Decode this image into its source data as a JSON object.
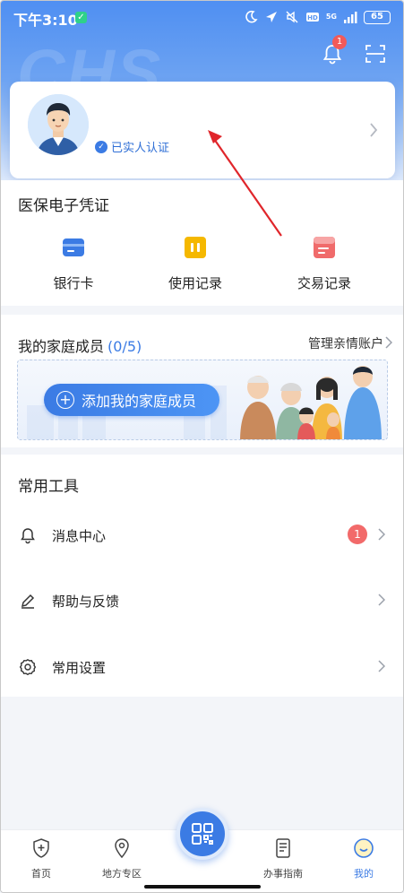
{
  "status_bar": {
    "time": "下午3:10",
    "battery": "65",
    "network": "5G"
  },
  "header": {
    "bell_badge": "1",
    "watermark": "CHS"
  },
  "profile": {
    "verified_label": "已实人认证"
  },
  "voucher": {
    "title": "医保电子凭证",
    "items": [
      {
        "label": "银行卡",
        "icon": "bank-card-icon",
        "color": "#3b7be4"
      },
      {
        "label": "使用记录",
        "icon": "usage-record-icon",
        "color": "#f5b800"
      },
      {
        "label": "交易记录",
        "icon": "transaction-record-icon",
        "color": "#f06b6b"
      }
    ]
  },
  "family": {
    "title": "我的家庭成员",
    "count": "(0/5)",
    "manage_label": "管理亲情账户",
    "add_button_label": "添加我的家庭成员"
  },
  "tools": {
    "title": "常用工具",
    "items": [
      {
        "label": "消息中心",
        "icon": "bell-icon",
        "badge": "1"
      },
      {
        "label": "帮助与反馈",
        "icon": "pen-icon"
      },
      {
        "label": "常用设置",
        "icon": "settings-icon"
      }
    ]
  },
  "bottom_nav": {
    "items": [
      {
        "label": "首页",
        "icon": "shield-plus-icon"
      },
      {
        "label": "地方专区",
        "icon": "location-pin-icon"
      },
      {
        "label": "办事指南",
        "icon": "document-icon"
      },
      {
        "label": "我的",
        "icon": "profile-face-icon",
        "active": true
      }
    ],
    "center_icon": "qr-code-icon"
  },
  "colors": {
    "accent": "#3b7be4",
    "badge": "#f15a5a",
    "page_bg": "#f3f5f9"
  }
}
